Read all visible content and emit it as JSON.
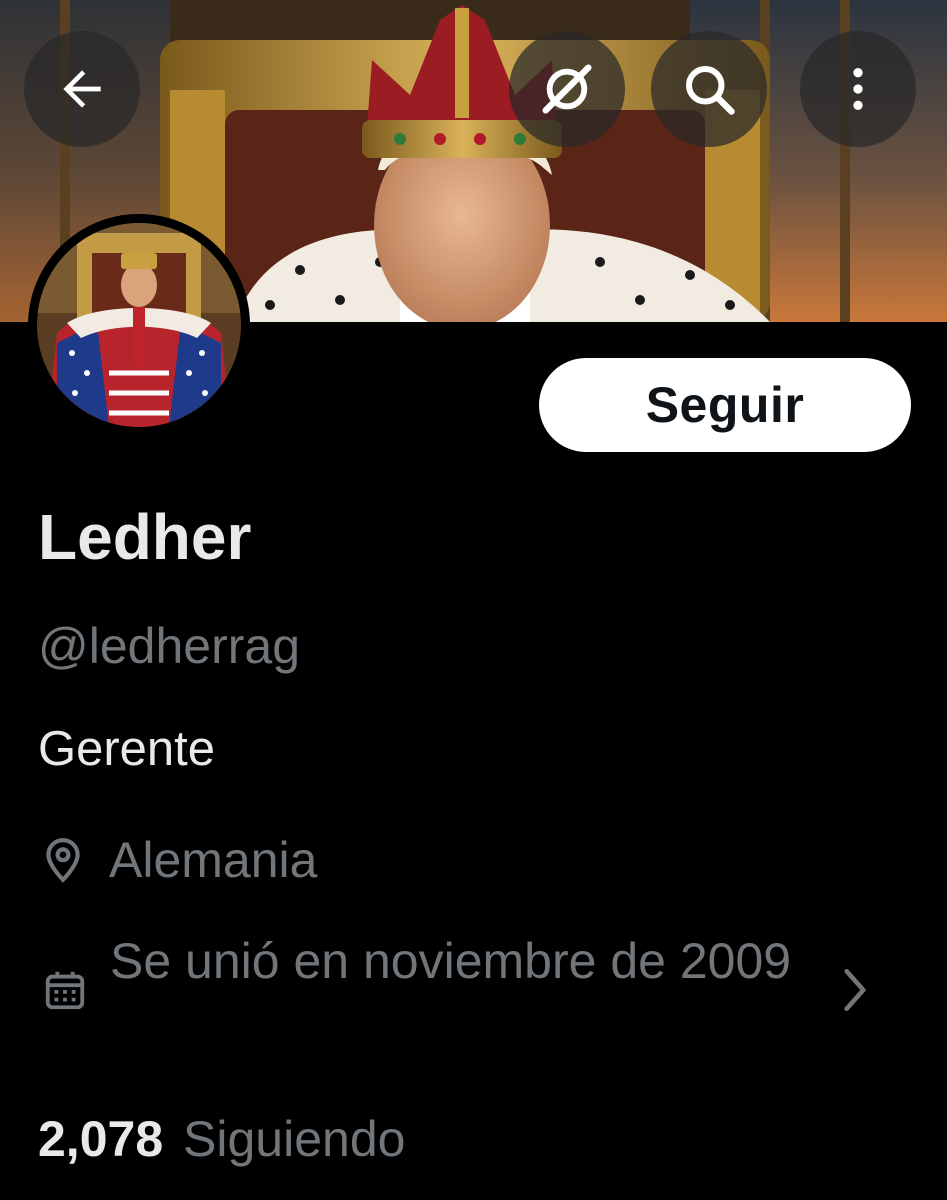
{
  "header": {
    "back_icon": "arrow-left-icon",
    "grok_icon": "grok-icon",
    "search_icon": "search-icon",
    "more_icon": "more-vertical-icon"
  },
  "profile": {
    "follow_label": "Seguir",
    "display_name": "Ledher",
    "handle": "@ledherrag",
    "bio": "Gerente",
    "location": "Alemania",
    "joined": "Se unió en noviembre de 2009",
    "following_count": "2,078",
    "following_label": "Siguiendo"
  },
  "colors": {
    "background": "#000000",
    "primary_text": "#e7e9ea",
    "secondary_text": "#71767b",
    "follow_button_bg": "#ffffff"
  }
}
